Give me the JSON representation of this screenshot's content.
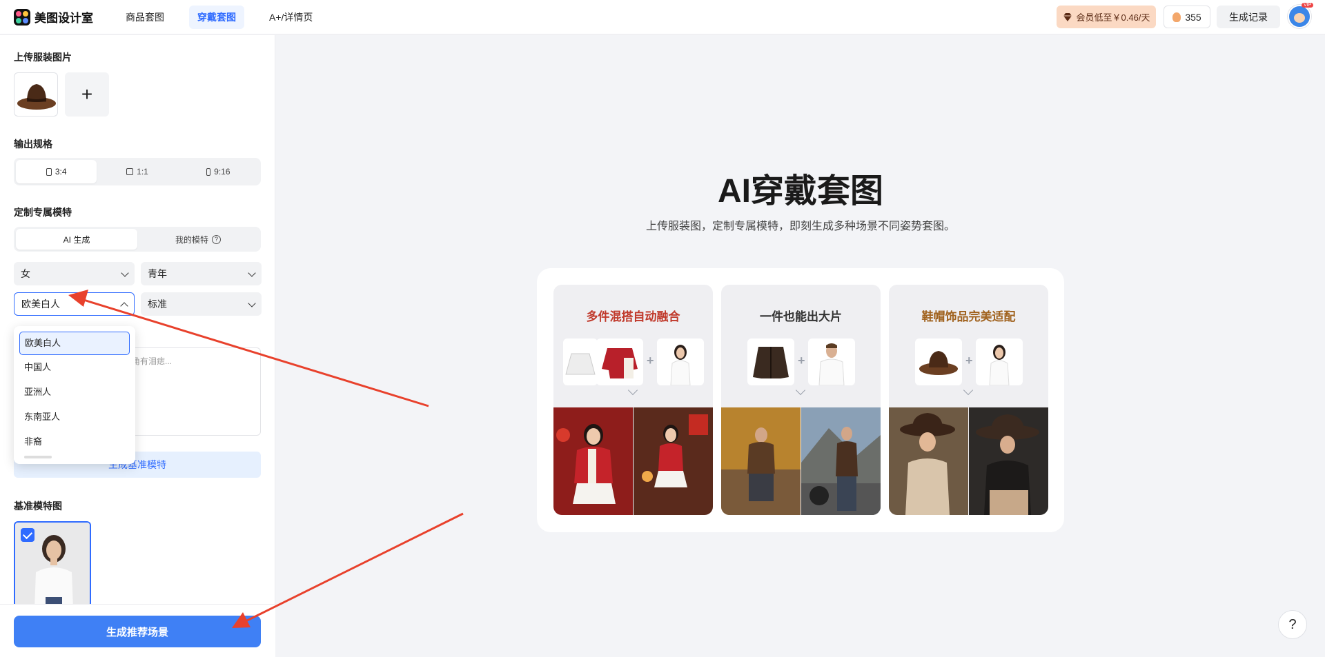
{
  "header": {
    "logo_text": "美图设计室",
    "tabs": [
      {
        "label": "商品套图"
      },
      {
        "label": "穿戴套图"
      },
      {
        "label": "A+/详情页"
      }
    ],
    "vip_promo": "会员低至￥0.46/天",
    "coins": "355",
    "history": "生成记录",
    "vip_badge": "VIP"
  },
  "sidebar": {
    "upload_title": "上传服装图片",
    "add_symbol": "+",
    "output_title": "输出规格",
    "ratios": [
      "3:4",
      "1:1",
      "9:16"
    ],
    "model_title": "定制专属模特",
    "model_tabs": [
      "AI 生成",
      "我的模特"
    ],
    "help_symbol": "?",
    "gender": "女",
    "age": "青年",
    "ethnicity": "欧美白人",
    "body": "标准",
    "ethnicity_options": [
      "欧美白人",
      "中国人",
      "亚洲人",
      "东南亚人",
      "非裔"
    ],
    "desc_placeholder_tail": "角有泪痣...",
    "generate_base": "生成基准模特",
    "base_title": "基准模特图",
    "generate_scene": "生成推荐场景"
  },
  "hero": {
    "title": "AI穿戴套图",
    "subtitle": "上传服装图，定制专属模特，即刻生成多种场景不同姿势套图。",
    "cards": [
      {
        "title": "多件混搭自动融合",
        "color": "#c0392b"
      },
      {
        "title": "一件也能出大片",
        "color": "#333333"
      },
      {
        "title": "鞋帽饰品完美适配",
        "color": "#a0621e"
      }
    ]
  },
  "help_fab": "?",
  "colors": {
    "accent": "#2f6bff",
    "annotation": "#e8412c"
  }
}
